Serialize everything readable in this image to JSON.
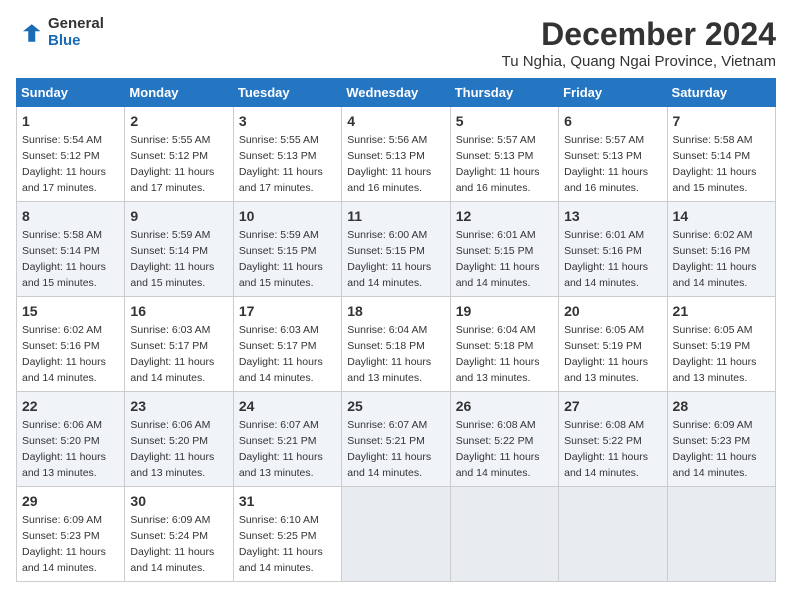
{
  "header": {
    "logo_general": "General",
    "logo_blue": "Blue",
    "month": "December 2024",
    "location": "Tu Nghia, Quang Ngai Province, Vietnam"
  },
  "columns": [
    "Sunday",
    "Monday",
    "Tuesday",
    "Wednesday",
    "Thursday",
    "Friday",
    "Saturday"
  ],
  "weeks": [
    [
      {
        "day": "1",
        "info": "Sunrise: 5:54 AM\nSunset: 5:12 PM\nDaylight: 11 hours and 17 minutes."
      },
      {
        "day": "2",
        "info": "Sunrise: 5:55 AM\nSunset: 5:12 PM\nDaylight: 11 hours and 17 minutes."
      },
      {
        "day": "3",
        "info": "Sunrise: 5:55 AM\nSunset: 5:13 PM\nDaylight: 11 hours and 17 minutes."
      },
      {
        "day": "4",
        "info": "Sunrise: 5:56 AM\nSunset: 5:13 PM\nDaylight: 11 hours and 16 minutes."
      },
      {
        "day": "5",
        "info": "Sunrise: 5:57 AM\nSunset: 5:13 PM\nDaylight: 11 hours and 16 minutes."
      },
      {
        "day": "6",
        "info": "Sunrise: 5:57 AM\nSunset: 5:13 PM\nDaylight: 11 hours and 16 minutes."
      },
      {
        "day": "7",
        "info": "Sunrise: 5:58 AM\nSunset: 5:14 PM\nDaylight: 11 hours and 15 minutes."
      }
    ],
    [
      {
        "day": "8",
        "info": "Sunrise: 5:58 AM\nSunset: 5:14 PM\nDaylight: 11 hours and 15 minutes."
      },
      {
        "day": "9",
        "info": "Sunrise: 5:59 AM\nSunset: 5:14 PM\nDaylight: 11 hours and 15 minutes."
      },
      {
        "day": "10",
        "info": "Sunrise: 5:59 AM\nSunset: 5:15 PM\nDaylight: 11 hours and 15 minutes."
      },
      {
        "day": "11",
        "info": "Sunrise: 6:00 AM\nSunset: 5:15 PM\nDaylight: 11 hours and 14 minutes."
      },
      {
        "day": "12",
        "info": "Sunrise: 6:01 AM\nSunset: 5:15 PM\nDaylight: 11 hours and 14 minutes."
      },
      {
        "day": "13",
        "info": "Sunrise: 6:01 AM\nSunset: 5:16 PM\nDaylight: 11 hours and 14 minutes."
      },
      {
        "day": "14",
        "info": "Sunrise: 6:02 AM\nSunset: 5:16 PM\nDaylight: 11 hours and 14 minutes."
      }
    ],
    [
      {
        "day": "15",
        "info": "Sunrise: 6:02 AM\nSunset: 5:16 PM\nDaylight: 11 hours and 14 minutes."
      },
      {
        "day": "16",
        "info": "Sunrise: 6:03 AM\nSunset: 5:17 PM\nDaylight: 11 hours and 14 minutes."
      },
      {
        "day": "17",
        "info": "Sunrise: 6:03 AM\nSunset: 5:17 PM\nDaylight: 11 hours and 14 minutes."
      },
      {
        "day": "18",
        "info": "Sunrise: 6:04 AM\nSunset: 5:18 PM\nDaylight: 11 hours and 13 minutes."
      },
      {
        "day": "19",
        "info": "Sunrise: 6:04 AM\nSunset: 5:18 PM\nDaylight: 11 hours and 13 minutes."
      },
      {
        "day": "20",
        "info": "Sunrise: 6:05 AM\nSunset: 5:19 PM\nDaylight: 11 hours and 13 minutes."
      },
      {
        "day": "21",
        "info": "Sunrise: 6:05 AM\nSunset: 5:19 PM\nDaylight: 11 hours and 13 minutes."
      }
    ],
    [
      {
        "day": "22",
        "info": "Sunrise: 6:06 AM\nSunset: 5:20 PM\nDaylight: 11 hours and 13 minutes."
      },
      {
        "day": "23",
        "info": "Sunrise: 6:06 AM\nSunset: 5:20 PM\nDaylight: 11 hours and 13 minutes."
      },
      {
        "day": "24",
        "info": "Sunrise: 6:07 AM\nSunset: 5:21 PM\nDaylight: 11 hours and 13 minutes."
      },
      {
        "day": "25",
        "info": "Sunrise: 6:07 AM\nSunset: 5:21 PM\nDaylight: 11 hours and 14 minutes."
      },
      {
        "day": "26",
        "info": "Sunrise: 6:08 AM\nSunset: 5:22 PM\nDaylight: 11 hours and 14 minutes."
      },
      {
        "day": "27",
        "info": "Sunrise: 6:08 AM\nSunset: 5:22 PM\nDaylight: 11 hours and 14 minutes."
      },
      {
        "day": "28",
        "info": "Sunrise: 6:09 AM\nSunset: 5:23 PM\nDaylight: 11 hours and 14 minutes."
      }
    ],
    [
      {
        "day": "29",
        "info": "Sunrise: 6:09 AM\nSunset: 5:23 PM\nDaylight: 11 hours and 14 minutes."
      },
      {
        "day": "30",
        "info": "Sunrise: 6:09 AM\nSunset: 5:24 PM\nDaylight: 11 hours and 14 minutes."
      },
      {
        "day": "31",
        "info": "Sunrise: 6:10 AM\nSunset: 5:25 PM\nDaylight: 11 hours and 14 minutes."
      },
      null,
      null,
      null,
      null
    ]
  ]
}
